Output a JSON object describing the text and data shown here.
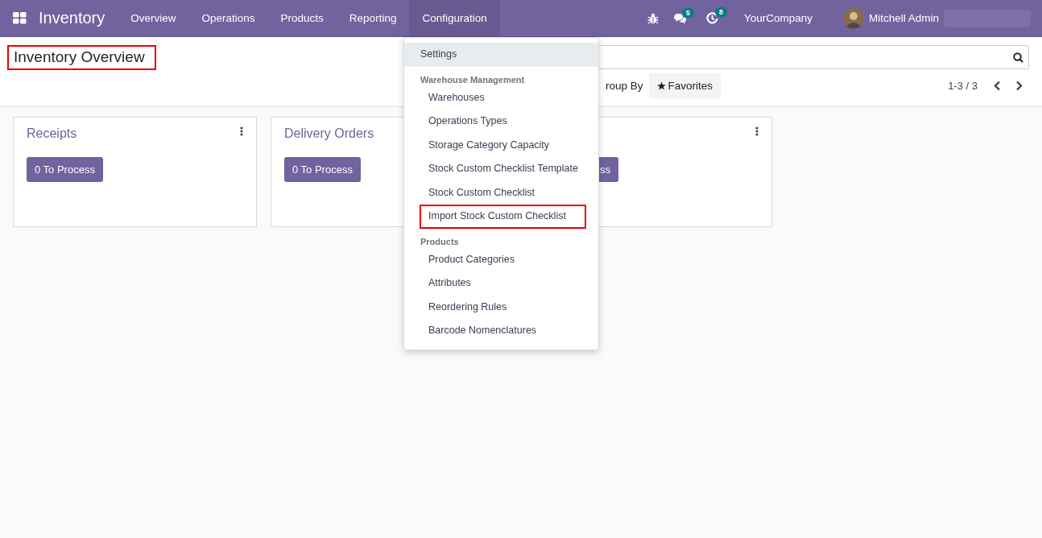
{
  "app": {
    "name": "Inventory"
  },
  "menu": [
    {
      "label": "Overview",
      "selected": false
    },
    {
      "label": "Operations",
      "selected": false
    },
    {
      "label": "Products",
      "selected": false
    },
    {
      "label": "Reporting",
      "selected": false
    },
    {
      "label": "Configuration",
      "selected": true
    }
  ],
  "systray": {
    "messages_count": "5",
    "activities_count": "8",
    "company": "YourCompany",
    "user": "Mitchell Admin"
  },
  "title": {
    "text": "Inventory Overview",
    "outlined": true
  },
  "search": {
    "group_by": "roup By",
    "favorites": "Favorites"
  },
  "pager": "1-3 / 3",
  "cards": [
    {
      "title": "Receipts",
      "button": "0 To Process"
    },
    {
      "title": "Delivery Orders",
      "button": "0 To Process"
    },
    {
      "button": "ss"
    }
  ],
  "dropdown": [
    {
      "kind": "item",
      "label": "Settings",
      "active": true,
      "outlined": false
    },
    {
      "kind": "header",
      "label": "Warehouse Management"
    },
    {
      "kind": "subitem",
      "label": "Warehouses",
      "active": false,
      "outlined": false
    },
    {
      "kind": "subitem",
      "label": "Operations Types",
      "active": false,
      "outlined": false
    },
    {
      "kind": "subitem",
      "label": "Storage Category Capacity",
      "active": false,
      "outlined": false
    },
    {
      "kind": "subitem",
      "label": "Stock Custom Checklist Template",
      "active": false,
      "outlined": false
    },
    {
      "kind": "subitem",
      "label": "Stock Custom Checklist",
      "active": false,
      "outlined": false
    },
    {
      "kind": "subitem",
      "label": "Import Stock Custom Checklist",
      "active": false,
      "outlined": true
    },
    {
      "kind": "header",
      "label": "Products"
    },
    {
      "kind": "subitem",
      "label": "Product Categories",
      "active": false,
      "outlined": false
    },
    {
      "kind": "subitem",
      "label": "Attributes",
      "active": false,
      "outlined": false
    },
    {
      "kind": "subitem",
      "label": "Reordering Rules",
      "active": false,
      "outlined": false
    },
    {
      "kind": "subitem",
      "label": "Barcode Nomenclatures",
      "active": false,
      "outlined": false
    }
  ]
}
